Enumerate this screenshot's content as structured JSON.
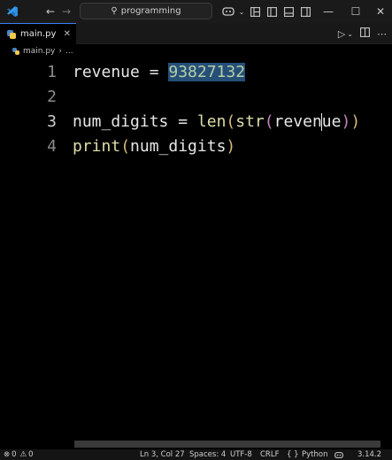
{
  "titlebar": {
    "search_text": "programming"
  },
  "tabs": [
    {
      "label": "main.py"
    }
  ],
  "breadcrumb": {
    "file": "main.py",
    "more": "..."
  },
  "editor": {
    "lines": [
      {
        "number": "1",
        "tokens": {
          "a": "revenue = ",
          "num": "93827132"
        }
      },
      {
        "number": "2"
      },
      {
        "number": "3",
        "tokens": {
          "a": "num_digits = ",
          "len": "len",
          "p1": "(",
          "str": "str",
          "p2": "(",
          "arg1": "reven",
          "arg2": "ue",
          "p3": ")",
          "p4": ")"
        }
      },
      {
        "number": "4",
        "tokens": {
          "print": "print",
          "p1": "(",
          "arg": "num_digits",
          "p2": ")"
        }
      }
    ]
  },
  "statusbar": {
    "errors": "0",
    "warnings": "0",
    "position": "Ln 3, Col 27",
    "spaces": "Spaces: 4",
    "encoding": "UTF-8",
    "eol": "CRLF",
    "braces": "{ }",
    "language": "Python",
    "version": "3.14.2"
  }
}
